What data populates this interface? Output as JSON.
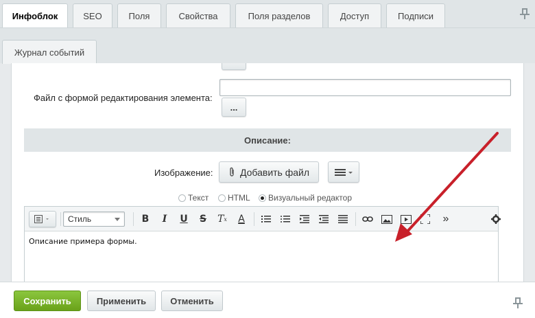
{
  "tabs": {
    "row1": [
      {
        "label": "Инфоблок",
        "active": true
      },
      {
        "label": "SEO",
        "active": false
      },
      {
        "label": "Поля",
        "active": false
      },
      {
        "label": "Свойства",
        "active": false
      },
      {
        "label": "Поля разделов",
        "active": false
      },
      {
        "label": "Доступ",
        "active": false
      },
      {
        "label": "Подписи",
        "active": false
      }
    ],
    "row2": [
      {
        "label": "Журнал событий",
        "active": false
      }
    ]
  },
  "form": {
    "edit_file_label": "Файл с формой редактирования элемента:",
    "edit_file_value": "",
    "browse_label": "...",
    "section_title": "Описание:",
    "image_label": "Изображение:",
    "add_file_label": "Добавить файл"
  },
  "editor": {
    "modes": [
      {
        "label": "Текст",
        "selected": false
      },
      {
        "label": "HTML",
        "selected": false
      },
      {
        "label": "Визуальный редактор",
        "selected": true
      }
    ],
    "style_select": "Стиль",
    "more": "»",
    "content": "Описание примера формы."
  },
  "footer": {
    "save": "Сохранить",
    "apply": "Применить",
    "cancel": "Отменить"
  },
  "colors": {
    "accent_green": "#7ab52a",
    "annotation_arrow": "#c8202a"
  }
}
